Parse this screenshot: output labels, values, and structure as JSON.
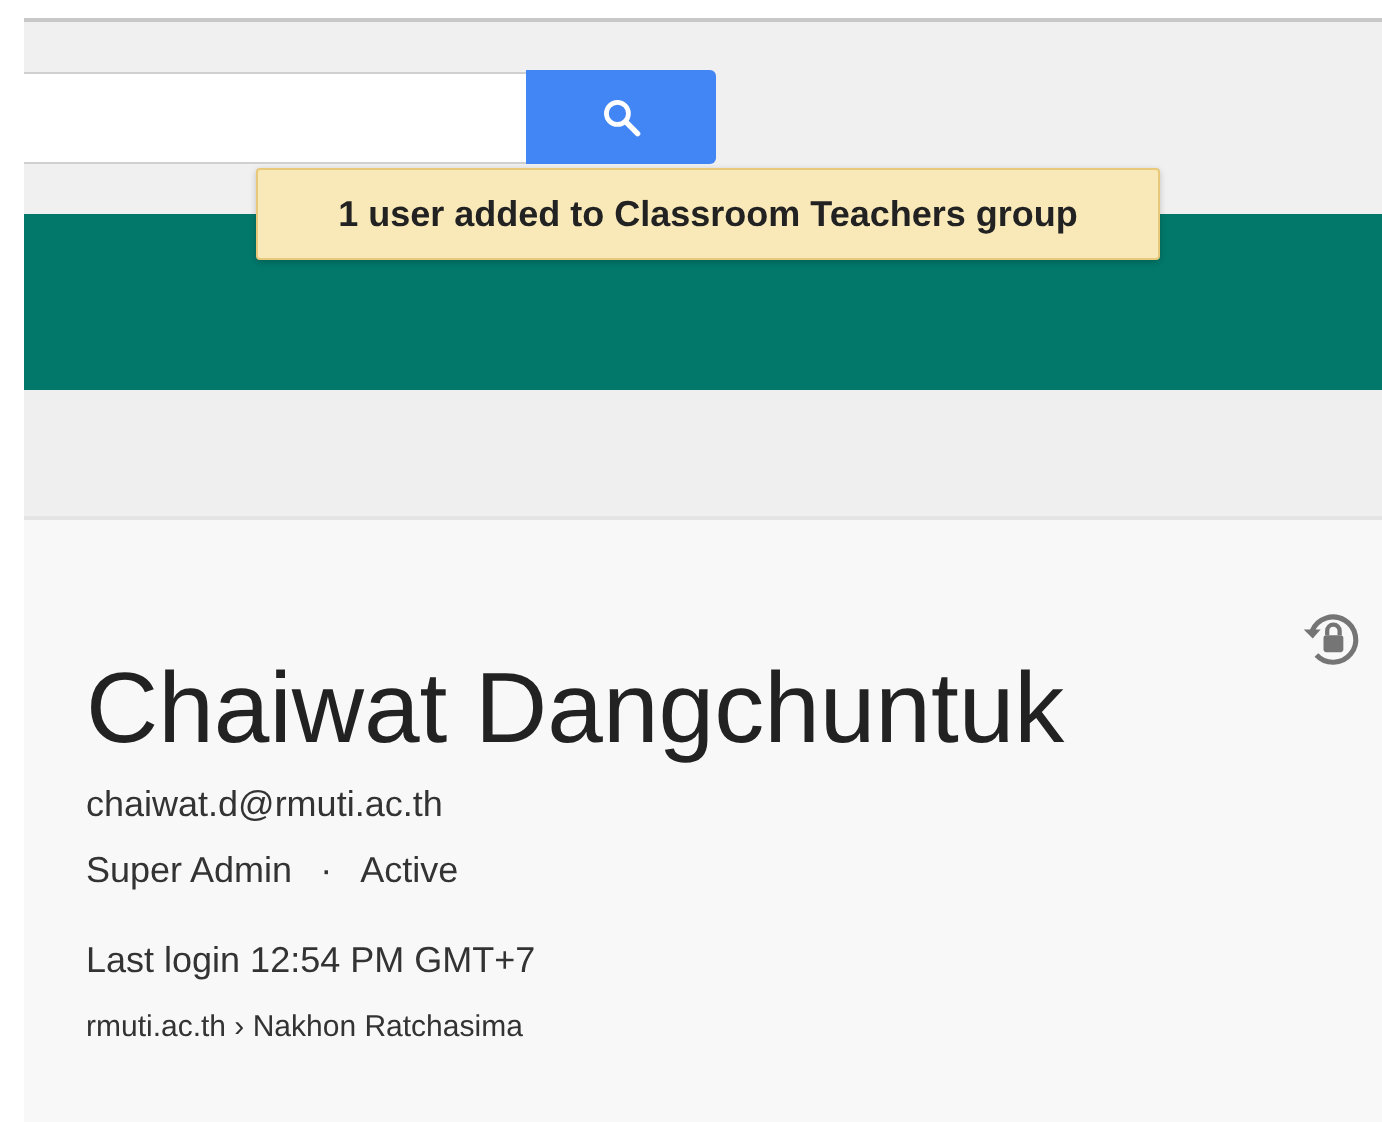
{
  "toast": {
    "text": "1 user added to Classroom Teachers group"
  },
  "user": {
    "name": "Chaiwat Dangchuntuk",
    "email": "chaiwat.d@rmuti.ac.th",
    "role": "Super Admin",
    "separator": "·",
    "status": "Active",
    "last_login": "Last login 12:54 PM GMT+7",
    "org_path": "rmuti.ac.th › Nakhon Ratchasima"
  }
}
